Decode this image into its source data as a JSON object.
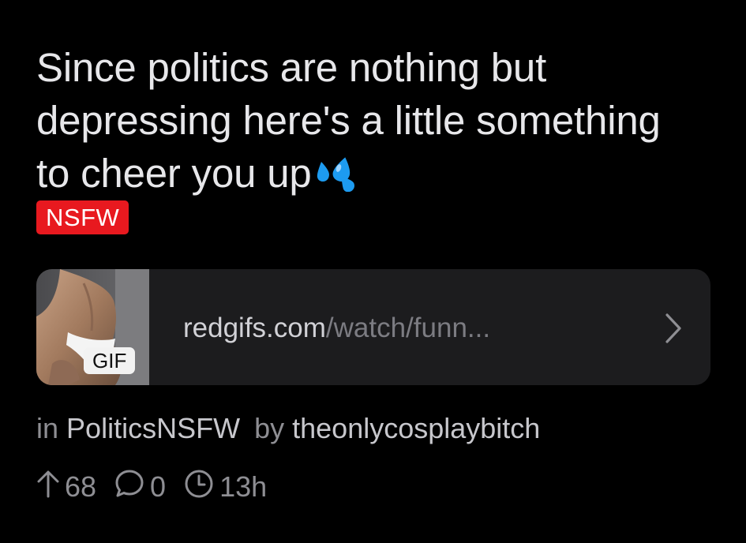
{
  "post": {
    "title": "Since politics are nothing but depressing here's a little something to cheer you up",
    "title_emoji": "sweat-droplets-emoji",
    "nsfw_label": "NSFW"
  },
  "link": {
    "domain": "redgifs.com",
    "path": "/watch/funn...",
    "badge": "GIF",
    "thumbnail_icon": "gif-thumbnail"
  },
  "meta": {
    "in_prefix": "in",
    "community": "PoliticsNSFW",
    "by_prefix": "by",
    "author": "theonlycosplaybitch"
  },
  "stats": {
    "upvotes": "68",
    "comments": "0",
    "age": "13h"
  },
  "colors": {
    "background": "#000000",
    "nsfw": "#e8191f",
    "card": "#1c1c1e",
    "meta_text": "#8e8e93",
    "emoji": "#1d9bf0"
  }
}
